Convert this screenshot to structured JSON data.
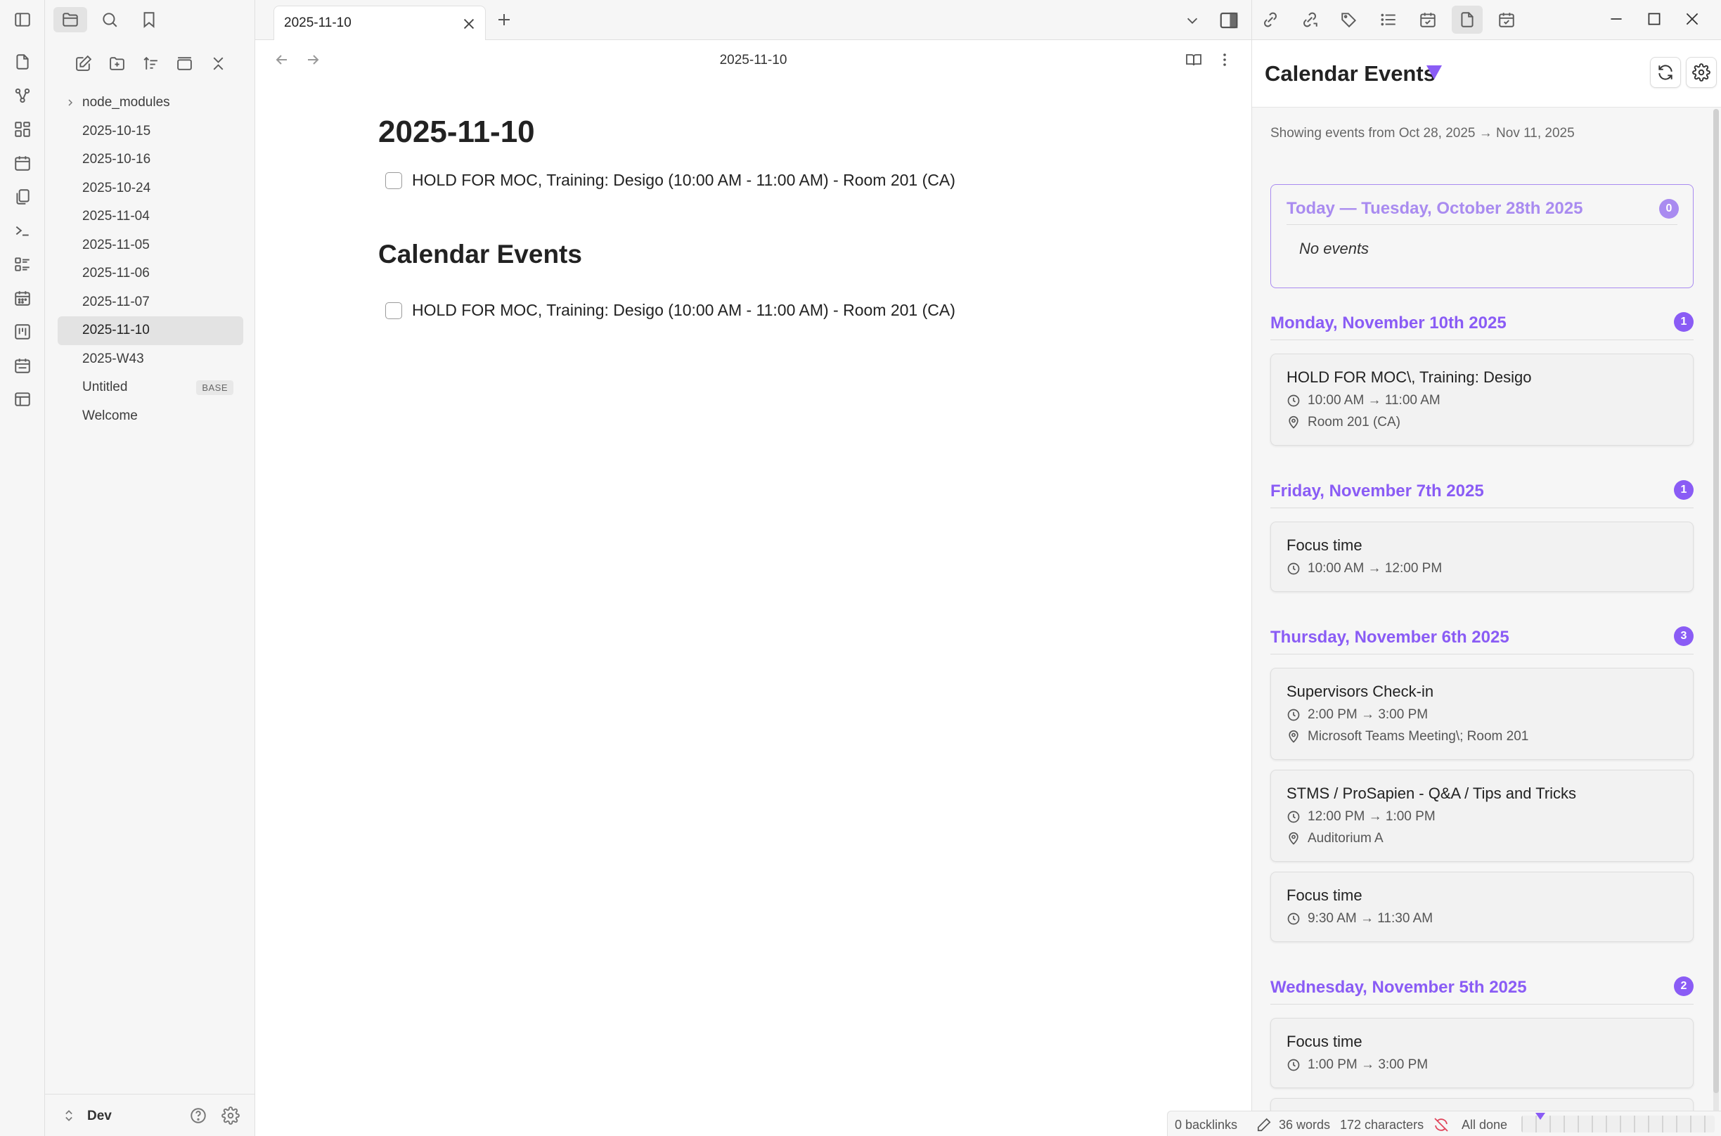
{
  "tabs": {
    "active_title": "2025-11-10"
  },
  "explorer": {
    "files": [
      {
        "label": "node_modules",
        "type": "folder"
      },
      {
        "label": "2025-10-15"
      },
      {
        "label": "2025-10-16"
      },
      {
        "label": "2025-10-24"
      },
      {
        "label": "2025-11-04"
      },
      {
        "label": "2025-11-05"
      },
      {
        "label": "2025-11-06"
      },
      {
        "label": "2025-11-07"
      },
      {
        "label": "2025-11-10",
        "active": true
      },
      {
        "label": "2025-W43"
      },
      {
        "label": "Untitled",
        "badge": "BASE"
      },
      {
        "label": "Welcome"
      }
    ],
    "vault_name": "Dev"
  },
  "editor": {
    "view_title": "2025-11-10",
    "note_title": "2025-11-10",
    "task_1": "HOLD FOR MOC, Training: Desigo (10:00 AM - 11:00 AM) - Room 201 (CA)",
    "heading": "Calendar Events",
    "task_2": "HOLD FOR MOC, Training: Desigo (10:00 AM - 11:00 AM) - Room 201 (CA)"
  },
  "panel": {
    "title": "Calendar Events",
    "range": "Showing events from Oct 28, 2025 → Nov 11, 2025",
    "today": {
      "title": "Today — Tuesday, October 28th 2025",
      "count": "0",
      "empty": "No events"
    },
    "days": [
      {
        "label": "Monday, November 10th 2025",
        "count": "1",
        "events": [
          {
            "title": "HOLD FOR MOC\\, Training: Desigo",
            "time": "10:00 AM → 11:00 AM",
            "location": "Room 201 (CA)"
          }
        ]
      },
      {
        "label": "Friday, November 7th 2025",
        "count": "1",
        "events": [
          {
            "title": "Focus time",
            "time": "10:00 AM → 12:00 PM"
          }
        ]
      },
      {
        "label": "Thursday, November 6th 2025",
        "count": "3",
        "events": [
          {
            "title": "Supervisors Check-in",
            "time": "2:00 PM → 3:00 PM",
            "location": "Microsoft Teams Meeting\\; Room 201"
          },
          {
            "title": "STMS / ProSapien - Q&A / Tips and Tricks",
            "time": "12:00 PM → 1:00 PM",
            "location": "Auditorium A"
          },
          {
            "title": "Focus time",
            "time": "9:30 AM → 11:30 AM"
          }
        ]
      },
      {
        "label": "Wednesday, November 5th 2025",
        "count": "2",
        "events": [
          {
            "title": "Focus time",
            "time": "1:00 PM → 3:00 PM"
          }
        ]
      }
    ]
  },
  "status": {
    "backlinks": "0 backlinks",
    "words": "36 words",
    "characters": "172 characters",
    "sync": "All done"
  },
  "colors": {
    "accent": "#8a5cf5",
    "accent_light": "#a98bf0"
  }
}
